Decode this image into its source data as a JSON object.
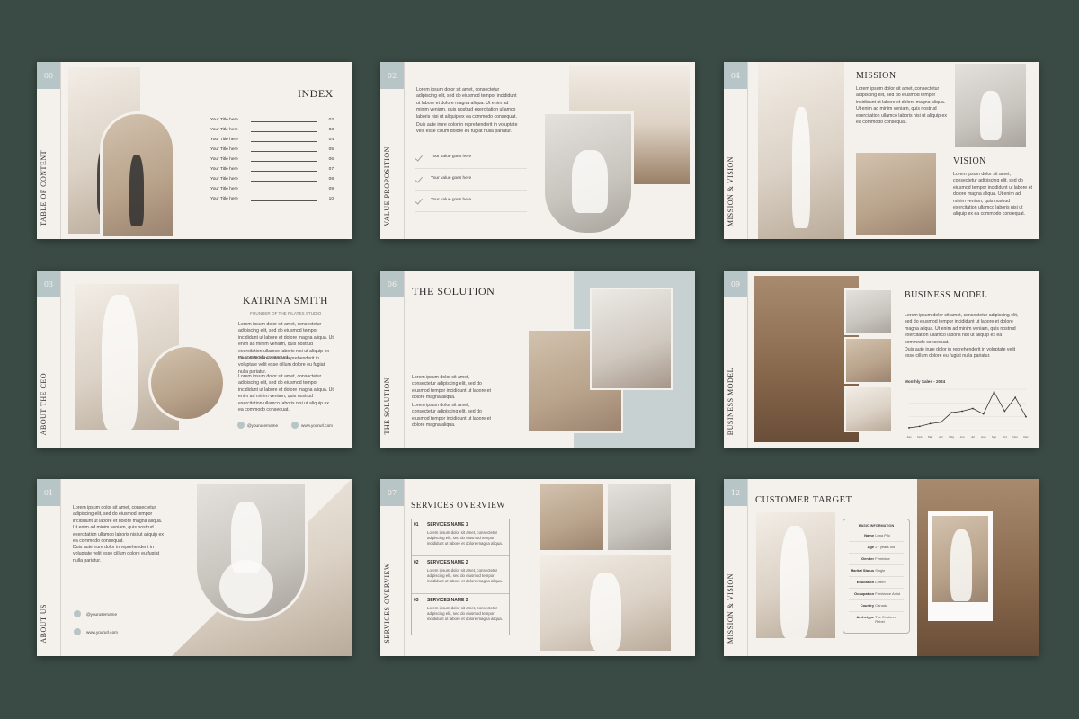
{
  "colors": {
    "background": "#3a4a44",
    "slide": "#f4f0ec",
    "accent": "#b8c5c6"
  },
  "slides": {
    "index": {
      "num": "00",
      "side": "TABLE OF CONTENT",
      "title": "INDEX",
      "items": [
        {
          "label": "Your Title here",
          "num": "02"
        },
        {
          "label": "Your Title here",
          "num": "03"
        },
        {
          "label": "Your Title here",
          "num": "04"
        },
        {
          "label": "Your Title here",
          "num": "05"
        },
        {
          "label": "Your Title here",
          "num": "06"
        },
        {
          "label": "Your Title here",
          "num": "07"
        },
        {
          "label": "Your Title here",
          "num": "08"
        },
        {
          "label": "Your Title here",
          "num": "09"
        },
        {
          "label": "Your Title here",
          "num": "10"
        }
      ]
    },
    "value": {
      "num": "02",
      "side": "VALUE PROPOSITION",
      "p1": "Lorem ipsum dolor sit amet, consectetur adipiscing elit, sed do eiusmod tempor incididunt ut labore et dolore magna aliqua. Ut enim ad minim veniam, quis nostrud exercitation ullamco laboris nisi ut aliquip ex ea commodo consequat.",
      "p2": "Duis aute irure dolor in reprehenderit in voluptate velit esse cillum dolore eu fugiat nulla pariatur.",
      "items": [
        "Your value goes here",
        "Your value goes here",
        "Your value goes here"
      ]
    },
    "mission": {
      "num": "04",
      "side": "MISSION & VISION",
      "mission_title": "MISSION",
      "vision_title": "VISION",
      "mission_text": "Lorem ipsum dolor sit amet, consectetur adipiscing elit, sed do eiusmod tempor incididunt ut labore et dolore magna aliqua. Ut enim ad minim veniam, quis nostrud exercitation ullamco laboris nisi ut aliquip ex ea commodo consequat.",
      "vision_text": "Lorem ipsum dolor sit amet, consectetur adipiscing elit, sed do eiusmod tempor incididunt ut labore et dolore magna aliqua. Ut enim ad minim veniam, quis nostrud exercitation ullamco laboris nisi ut aliquip ex ea commodo consequat."
    },
    "ceo": {
      "num": "03",
      "side": "ABOUT THE CEO",
      "name": "KATRINA SMITH",
      "role": "FOUNDER OF THE PILATES STUDIO",
      "p1": "Lorem ipsum dolor sit amet, consectetur adipiscing elit, sed do eiusmod tempor incididunt ut labore et dolore magna aliqua. Ut enim ad minim veniam, quis nostrud exercitation ullamco laboris nisi ut aliquip ex ea commodo consequat.",
      "p2": "Duis aute irure dolor in reprehenderit in voluptate velit esse cillum dolore eu fugiat nulla pariatur.",
      "p3": "Lorem ipsum dolor sit amet, consectetur adipiscing elit, sed do eiusmod tempor incididunt ut labore et dolore magna aliqua. Ut enim ad minim veniam, quis nostrud exercitation ullamco laboris nisi ut aliquip ex ea commodo consequat.",
      "username": "@yourusername",
      "url": "www.yoururl.com"
    },
    "solution": {
      "num": "06",
      "side": "THE SOLUTION",
      "title": "THE SOLUTION",
      "p1": "Lorem ipsum dolor sit amet, consectetur adipiscing elit, sed do eiusmod tempor incididunt ut labore et dolore magna aliqua.",
      "p2": "Lorem ipsum dolor sit amet, consectetur adipiscing elit, sed do eiusmod tempor incididunt ut labore et dolore magna aliqua."
    },
    "business": {
      "num": "09",
      "side": "BUSINESS MODEL",
      "title": "BUSINESS MODEL",
      "p1": "Lorem ipsum dolor sit amet, consectetur adipiscing elit, sed do eiusmod tempor incididunt ut labore et dolore magna aliqua. Ut enim ad minim veniam, quis nostrud exercitation ullamco laboris nisi ut aliquip ex ea commodo consequat.",
      "p2": "Duis aute irure dolor in reprehenderit in voluptate velit esse cillum dolore eu fugiat nulla pariatur.",
      "chart_title": "Monthly Sales - 2024"
    },
    "about": {
      "num": "01",
      "side": "ABOUT US",
      "p1": "Lorem ipsum dolor sit amet, consectetur adipiscing elit, sed do eiusmod tempor incididunt ut labore et dolore magna aliqua. Ut enim ad minim veniam, quis nostrud exercitation ullamco laboris nisi ut aliquip ex ea commodo consequat.",
      "p2": "Duis aute irure dolor in reprehenderit in voluptate velit esse cillum dolore eu fugiat nulla pariatur.",
      "username": "@yourusername",
      "url": "www.yoururl.com"
    },
    "services": {
      "num": "07",
      "side": "SERVICES OVERVIEW",
      "title": "SERVICES OVERVIEW",
      "items": [
        {
          "num": "01",
          "name": "SERVICES NAME 1",
          "text": "Lorem ipsum dolor sit amet, consectetur adipiscing elit, sed do eiusmod tempor incididunt ut labore et dolore magna aliqua."
        },
        {
          "num": "02",
          "name": "SERVICES NAME 2",
          "text": "Lorem ipsum dolor sit amet, consectetur adipiscing elit, sed do eiusmod tempor incididunt ut labore et dolore magna aliqua."
        },
        {
          "num": "03",
          "name": "SERVICES NAME 3",
          "text": "Lorem ipsum dolor sit amet, consectetur adipiscing elit, sed do eiusmod tempor incididunt ut labore et dolore magna aliqua."
        }
      ]
    },
    "customer": {
      "num": "12",
      "side": "MISSION & VISION",
      "title": "CUSTOMER TARGET",
      "card_title": "BASIC INFORMATION",
      "fields": [
        {
          "k": "Name",
          "v": "Luna Pilo"
        },
        {
          "k": "Age",
          "v": "27 years old"
        },
        {
          "k": "Gender",
          "v": "Feminine"
        },
        {
          "k": "Marital Status",
          "v": "Single"
        },
        {
          "k": "Education",
          "v": "Lorem"
        },
        {
          "k": "Occupation",
          "v": "Freelance Artist"
        },
        {
          "k": "Country",
          "v": "Canada"
        },
        {
          "k": "Archetype",
          "v": "The Explorer Rebel"
        }
      ]
    }
  },
  "chart_data": {
    "type": "line",
    "title": "Monthly Sales - 2024",
    "categories": [
      "Jan",
      "Feb",
      "Mar",
      "Apr",
      "May",
      "Jun",
      "Jul",
      "Aug",
      "Sep",
      "Oct",
      "Nov",
      "Dec"
    ],
    "values": [
      2,
      3,
      5,
      6,
      13,
      14,
      16,
      12,
      28,
      14,
      24,
      10
    ],
    "ylim": [
      0,
      30
    ]
  }
}
